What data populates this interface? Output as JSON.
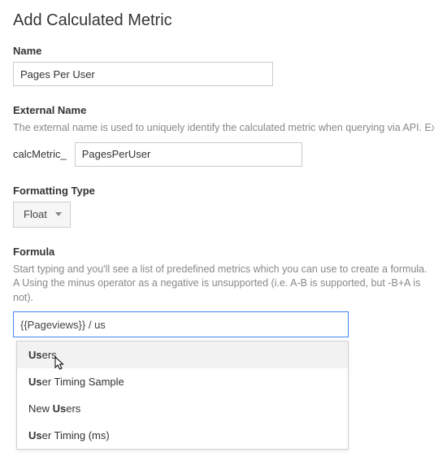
{
  "title": "Add Calculated Metric",
  "name": {
    "label": "Name",
    "value": "Pages Per User"
  },
  "external_name": {
    "label": "External Name",
    "help": "The external name is used to uniquely identify the calculated metric when querying via API. External name characters, symbols, and spaces are not allowed.",
    "prefix": "calcMetric_",
    "value": "PagesPerUser"
  },
  "formatting_type": {
    "label": "Formatting Type",
    "selected": "Float"
  },
  "formula": {
    "label": "Formula",
    "help": "Start typing and you'll see a list of predefined metrics which you can use to create a formula. A Using the minus operator as a negative is unsupported (i.e. A-B is supported, but -B+A is not).",
    "value": "{{Pageviews}} / us",
    "suggestions": [
      {
        "text": "Users",
        "match": "Us",
        "highlighted": true
      },
      {
        "text": "User Timing Sample",
        "match": "Us",
        "highlighted": false
      },
      {
        "text": "New Users",
        "match": "Us",
        "highlighted": false
      },
      {
        "text": "User Timing (ms)",
        "match": "Us",
        "highlighted": false
      }
    ]
  }
}
